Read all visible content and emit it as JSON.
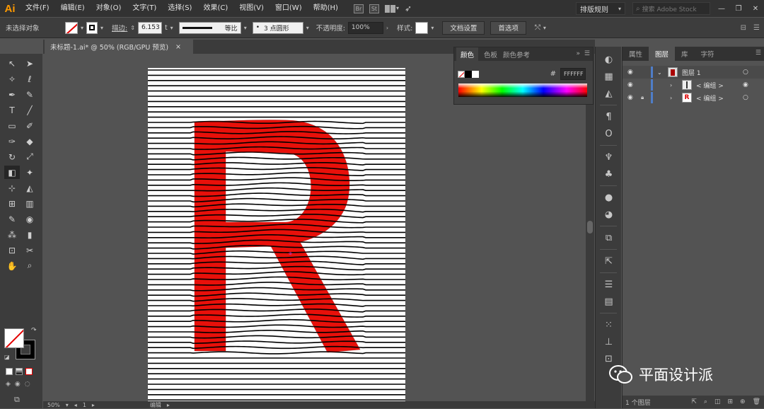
{
  "app": {
    "logo": "Ai"
  },
  "menu": [
    "文件(F)",
    "编辑(E)",
    "对象(O)",
    "文字(T)",
    "选择(S)",
    "效果(C)",
    "视图(V)",
    "窗口(W)",
    "帮助(H)"
  ],
  "menubar_right": {
    "workspace": "排版规则",
    "search_placeholder": "搜索 Adobe Stock",
    "st_badge": "St"
  },
  "control": {
    "selection_label": "未选择对象",
    "stroke_label": "描边:",
    "stroke_value": "6.153",
    "stroke_unit": "t",
    "profile_label": "等比",
    "brush_label": "3 点圆形",
    "opacity_label": "不透明度:",
    "opacity_value": "100%",
    "style_label": "样式:",
    "doc_setup_btn": "文档设置",
    "prefs_btn": "首选项"
  },
  "doc_tab": {
    "title": "未标题-1.ai* @ 50% (RGB/GPU 预览)",
    "close": "×"
  },
  "color_panel": {
    "tabs": [
      "颜色",
      "色板",
      "颜色参考"
    ],
    "hex_prefix": "#",
    "hex_value": "FFFFFF"
  },
  "layers_panel": {
    "tabs": [
      "属性",
      "图层",
      "库",
      "字符"
    ],
    "rows": [
      {
        "name": "图层 1",
        "thumb": ""
      },
      {
        "name": "< 编组 >",
        "thumb": ""
      },
      {
        "name": "< 编组 >",
        "thumb": "R"
      }
    ],
    "footer": "1 个图层"
  },
  "status": {
    "zoom": "50%",
    "page": "1",
    "mode": "编辑"
  },
  "artwork": {
    "letter": "R",
    "letter_color": "#e8100a",
    "line_color": "#000000"
  },
  "watermark": {
    "text": "平面设计派"
  }
}
